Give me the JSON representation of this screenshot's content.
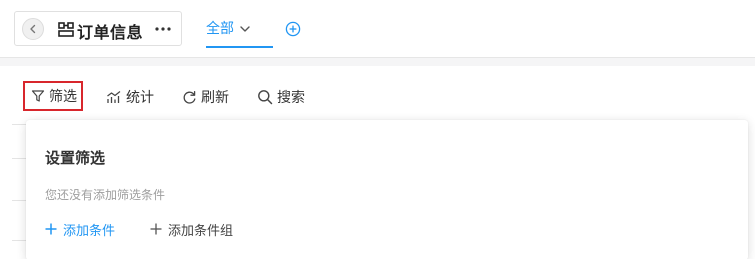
{
  "header": {
    "title": "订单信息",
    "more_label": "···",
    "view_tab": {
      "label": "全部"
    }
  },
  "toolbar": {
    "filter_label": "筛选",
    "stats_label": "统计",
    "refresh_label": "刷新",
    "search_label": "搜索"
  },
  "filter_panel": {
    "title": "设置筛选",
    "empty_text": "您还没有添加筛选条件",
    "add_condition_label": "添加条件",
    "add_group_label": "添加条件组"
  },
  "colors": {
    "accent": "#2196f3",
    "highlight_border": "#d8262c",
    "page_background": "#f5f5f6"
  },
  "icons": [
    "chevron-left-icon",
    "worksheet-icon",
    "more-icon",
    "chevron-down-icon",
    "add-circle-icon",
    "filter-icon",
    "chart-icon",
    "refresh-icon",
    "search-icon",
    "plus-icon"
  ]
}
